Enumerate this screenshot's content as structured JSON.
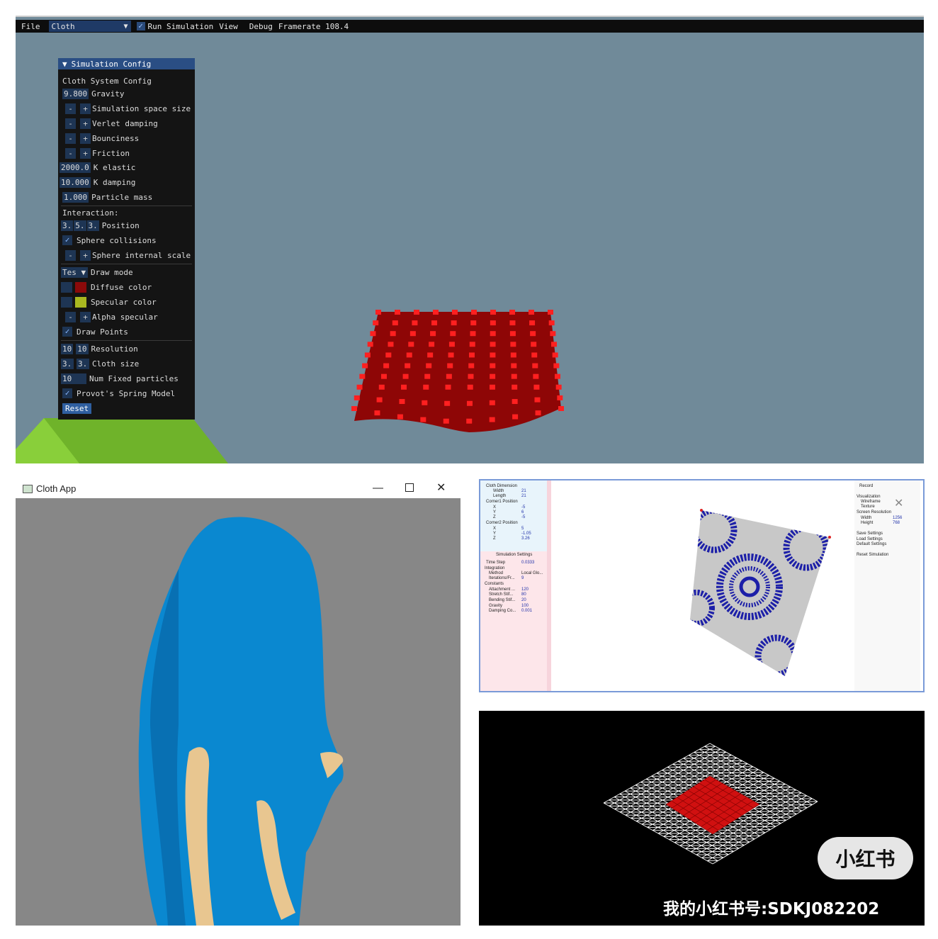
{
  "top": {
    "menu": {
      "file": "File",
      "combo_value": "Cloth",
      "run_label": "Run Simulation",
      "view": "View",
      "debug": "Debug",
      "framerate": "Framerate 108.4"
    },
    "sim": {
      "title": "Simulation Config",
      "section_cloth": "Cloth System Config",
      "gravity_val": "9.800",
      "gravity_label": "Gravity",
      "space_size": "Simulation space size",
      "verlet": "Verlet damping",
      "bounciness": "Bounciness",
      "friction": "Friction",
      "kelastic_val": "2000.0",
      "kelastic_label": "K elastic",
      "kdamping_val": "10.000",
      "kdamping_label": "K damping",
      "mass_val": "1.000",
      "mass_label": "Particle mass",
      "interaction": "Interaction:",
      "pos_vals": [
        "3.",
        "5.",
        "3."
      ],
      "pos_label": "Position",
      "sphere_coll": "Sphere collisions",
      "sphere_scale": "Sphere internal scale",
      "draw_mode_val": "Tes",
      "draw_mode_label": "Draw mode",
      "diffuse_label": "Diffuse color",
      "specular_label": "Specular color",
      "alpha_label": "Alpha specular",
      "draw_points": "Draw Points",
      "res_vals": [
        "10",
        "10"
      ],
      "res_label": "Resolution",
      "size_vals": [
        "3.",
        "3."
      ],
      "size_label": "Cloth size",
      "fixed_val": "10",
      "fixed_label": "Num Fixed particles",
      "provot": "Provot's Spring Model",
      "reset": "Reset",
      "colors": {
        "diffuse": "#8b0a0a",
        "specular": "#a9b820"
      }
    }
  },
  "bottom_left": {
    "window_title": "Cloth App",
    "cloth_color": "#0a88d0",
    "body_color": "#e8c690"
  },
  "bottom_right_top": {
    "left_panel": {
      "cloth_dimension": "Cloth Dimension",
      "width_label": "Width",
      "width_val": "21",
      "length_label": "Length",
      "length_val": "21",
      "corner1": "Corner1 Position",
      "c1x": "-5",
      "c1y": "6",
      "c1z": "-5",
      "corner2": "Corner2 Position",
      "c2x": "5",
      "c2y": "-1.05",
      "c2z": "3.26",
      "sim_settings": "Simulation Settings",
      "time_step_label": "Time Step",
      "time_step_val": "0.0333",
      "integration": "Integration",
      "method_label": "Method",
      "method_val": "Local Glo...",
      "iter_label": "Iterations/Fr...",
      "iter_val": "9",
      "constants": "Constants",
      "attach_label": "Attachment ...",
      "attach_val": "120",
      "stretch_label": "Stretch Stif...",
      "stretch_val": "80",
      "bending_label": "Bending Stif...",
      "bending_val": "20",
      "gravity_label": "Gravity",
      "gravity_val": "100",
      "damping_label": "Damping Co...",
      "damping_val": "0.001"
    },
    "right_panel": {
      "record": "Record",
      "visualization": "Visualization",
      "wireframe": "Wireframe",
      "texture": "Texture",
      "screen_res": "Screen Resolution",
      "width_label": "Width",
      "width_val": "1256",
      "height_label": "Height",
      "height_val": "768",
      "save": "Save Settings",
      "load": "Load Settings",
      "default": "Default Settings",
      "reset": "Reset Simulation"
    }
  },
  "bottom_right_bottom": {
    "logo": "小红书",
    "watermark": "我的小红书号:SDKJ082202"
  }
}
